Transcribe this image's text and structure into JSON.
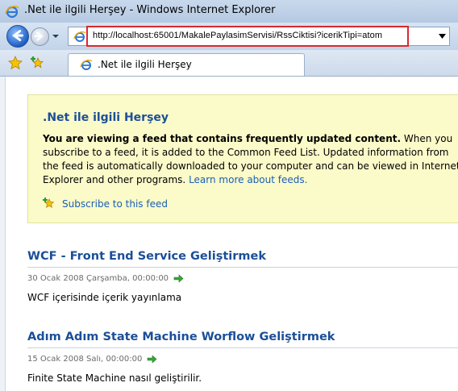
{
  "window": {
    "title": ".Net ile ilgili Herşey - Windows Internet Explorer"
  },
  "address_bar": {
    "url": "http://localhost:65001/MakalePaylasimServisi/RssCiktisi?icerikTipi=atom"
  },
  "tab": {
    "label": ".Net ile ilgili Herşey"
  },
  "feed_box": {
    "title": ".Net ile ilgili Herşey",
    "desc_bold": "You are viewing a feed that contains frequently updated content.",
    "desc_text": " When you subscribe to a feed, it is added to the Common Feed List. Updated information from the feed is automatically downloaded to your computer and can be viewed in Internet Explorer and other programs. ",
    "learn_more": "Learn more about feeds.",
    "subscribe": "Subscribe to this feed"
  },
  "articles": [
    {
      "title": "WCF - Front End Service Geliştirmek",
      "date": "30 Ocak 2008 Çarşamba, 00:00:00",
      "body": "WCF içerisinde içerik yayınlama"
    },
    {
      "title": "Adım Adım State Machine Worflow Geliştirmek",
      "date": "15 Ocak 2008 Salı, 00:00:00",
      "body": "Finite State Machine nasıl geliştirilir."
    }
  ],
  "colors": {
    "link": "#1a5fb4",
    "heading": "#1b4f98",
    "feed_box_bg": "#fbfac9",
    "highlight": "#d9292e"
  },
  "icons": [
    "ie-icon",
    "back-icon",
    "forward-icon",
    "favorites-star-icon",
    "add-favorites-icon",
    "subscribe-icon",
    "go-arrow-icon"
  ]
}
